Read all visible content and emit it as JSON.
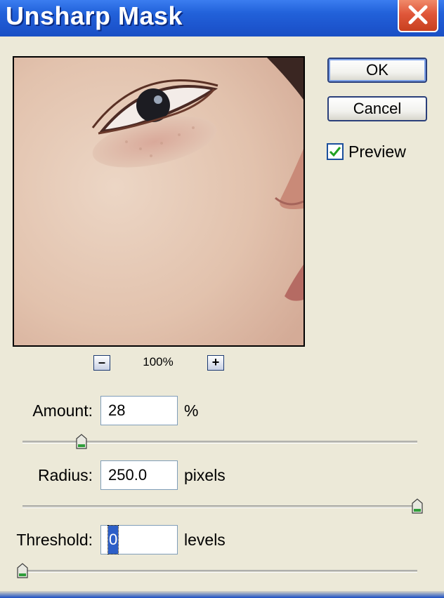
{
  "window": {
    "title": "Unsharp Mask"
  },
  "buttons": {
    "ok_label": "OK",
    "cancel_label": "Cancel"
  },
  "preview": {
    "label": "Preview",
    "checked": true
  },
  "zoom": {
    "minus_label": "–",
    "plus_label": "+",
    "level": "100%"
  },
  "fields": {
    "amount": {
      "label": "Amount:",
      "value": "28",
      "unit": "%",
      "slider_fraction": 0.15
    },
    "radius": {
      "label": "Radius:",
      "value": "250.0",
      "unit": "pixels",
      "slider_fraction": 1.0
    },
    "threshold": {
      "label": "Threshold:",
      "value": "0",
      "unit": "levels",
      "slider_fraction": 0.0
    }
  },
  "colors": {
    "titlebar": "#2262da",
    "close": "#e0573a",
    "dialog_bg": "#ece9d8",
    "checkmark": "#21a121"
  },
  "icons": {
    "close": "close-x-icon",
    "check": "checkmark-icon",
    "slider": "slider-thumb-icon"
  }
}
